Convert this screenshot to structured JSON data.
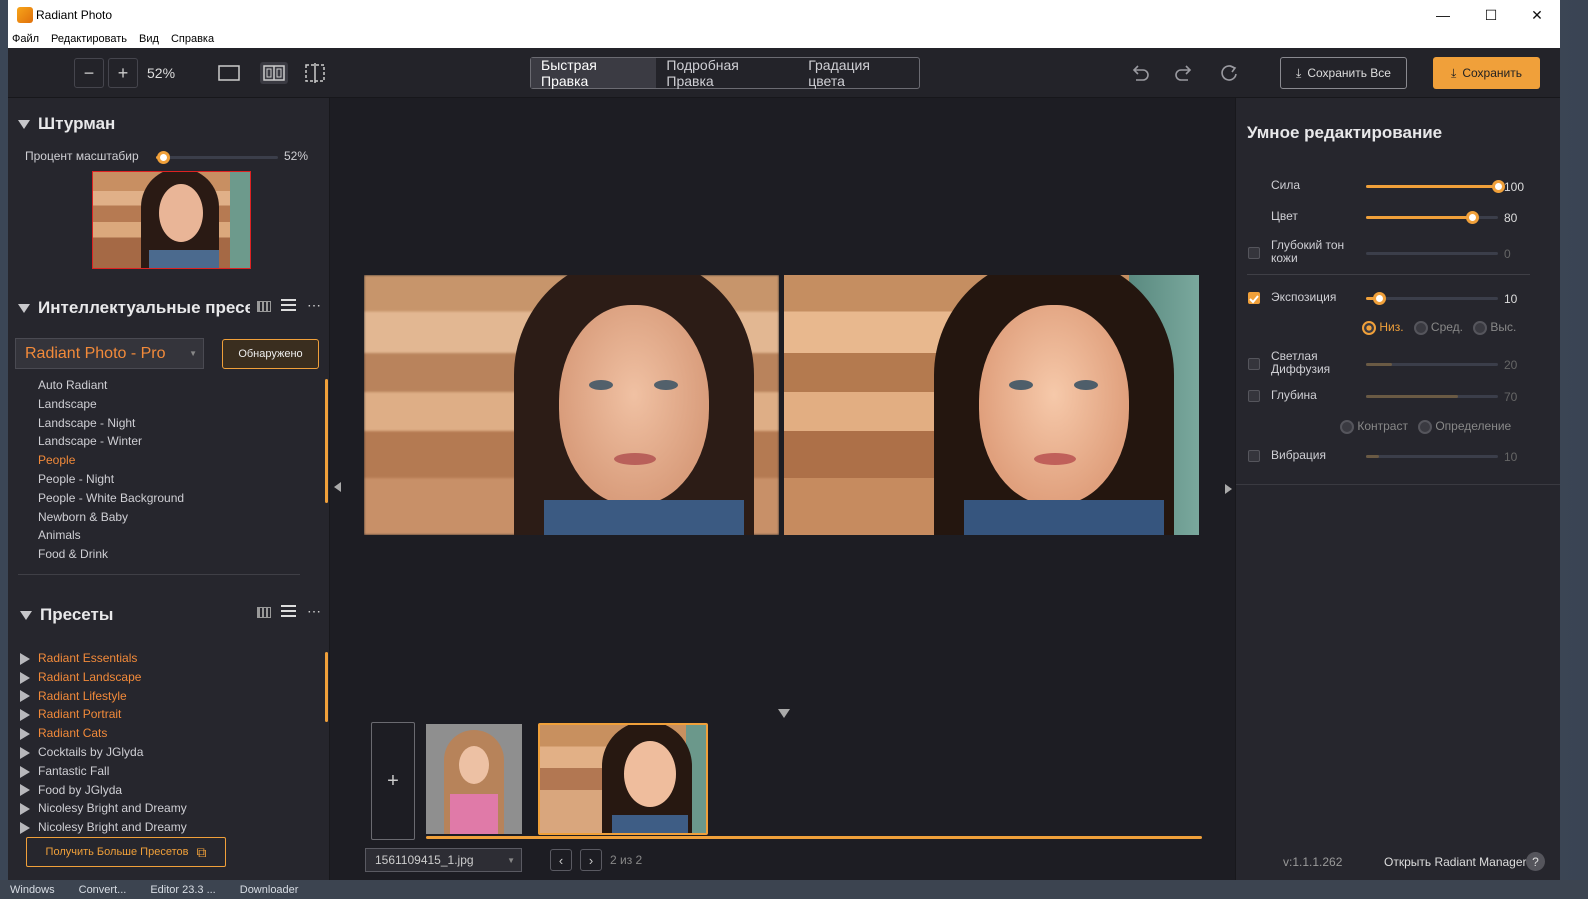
{
  "window": {
    "title": "Radiant Photo",
    "minimize": "—",
    "maximize": "☐",
    "close": "✕"
  },
  "menu": [
    "Файл",
    "Редактировать",
    "Вид",
    "Справка"
  ],
  "toolbar": {
    "zoom_out": "−",
    "zoom_in": "+",
    "zoom_value": "52%",
    "tabs": [
      "Быстрая Правка",
      "Подробная Правка",
      "Градация цвета"
    ],
    "active_tab": 0,
    "save_all": "Сохранить Все",
    "save": "Сохранить"
  },
  "navigator": {
    "title": "Штурман",
    "scale_label": "Процент масштабир",
    "scale_value": "52%",
    "scale_fraction": 0.06
  },
  "smart_presets": {
    "title": "Интеллектуальные пресе",
    "selected": "Radiant Photo - Pro",
    "detected_button": "Обнаружено",
    "items": [
      "Auto Radiant",
      "Landscape",
      "Landscape - Night",
      "Landscape - Winter",
      "People",
      "People - Night",
      "People - White Background",
      "Newborn & Baby",
      "Animals",
      "Food & Drink"
    ],
    "active_index": 4
  },
  "presets": {
    "title": "Пресеты",
    "items": [
      {
        "label": "Radiant Essentials",
        "highlight": true
      },
      {
        "label": "Radiant Landscape",
        "highlight": true
      },
      {
        "label": "Radiant Lifestyle",
        "highlight": true
      },
      {
        "label": "Radiant Portrait",
        "highlight": true
      },
      {
        "label": "Radiant Cats",
        "highlight": true
      },
      {
        "label": "Cocktails by JGlyda",
        "highlight": false
      },
      {
        "label": "Fantastic Fall",
        "highlight": false
      },
      {
        "label": "Food by JGlyda",
        "highlight": false
      },
      {
        "label": "Nicolesy Bright and Dreamy",
        "highlight": false
      },
      {
        "label": "Nicolesy Bright and Dreamy",
        "highlight": false
      }
    ],
    "get_more": "Получить Больше Пресетов"
  },
  "smart_edit": {
    "title": "Умное редактирование",
    "controls": [
      {
        "label": "Сила",
        "value": "100",
        "fraction": 1.0,
        "enabled": true,
        "checkbox": false
      },
      {
        "label": "Цвет",
        "value": "80",
        "fraction": 0.8,
        "enabled": true,
        "checkbox": false
      },
      {
        "label": "Глубокий тон кожи",
        "value": "0",
        "fraction": 0.0,
        "enabled": false,
        "checkbox": true,
        "checked": false
      },
      {
        "label": "Экспозиция",
        "value": "10",
        "fraction": 0.1,
        "enabled": true,
        "checkbox": true,
        "checked": true
      },
      {
        "label": "Светлая Диффузия",
        "value": "20",
        "fraction": 0.2,
        "enabled": false,
        "checkbox": true,
        "checked": false
      },
      {
        "label": "Глубина",
        "value": "70",
        "fraction": 0.7,
        "enabled": false,
        "checkbox": true,
        "checked": false
      },
      {
        "label": "Вибрация",
        "value": "10",
        "fraction": 0.1,
        "enabled": false,
        "checkbox": true,
        "checked": false
      }
    ],
    "exposure_options": [
      "Низ.",
      "Сред.",
      "Выс."
    ],
    "exposure_selected": 0,
    "depth_options": [
      "Контраст",
      "Определение"
    ]
  },
  "filmstrip": {
    "add": "+",
    "filename": "1561109415_1.jpg",
    "counter": "2 из 2"
  },
  "footer": {
    "version": "v:1.1.1.262",
    "manager": "Открыть Radiant Manager",
    "help": "?"
  },
  "taskbar": [
    "Windows",
    "Convert...",
    "Editor 23.3 ...",
    "Downloader"
  ],
  "colors": {
    "accent": "#f0a03a",
    "background": "#222228"
  }
}
